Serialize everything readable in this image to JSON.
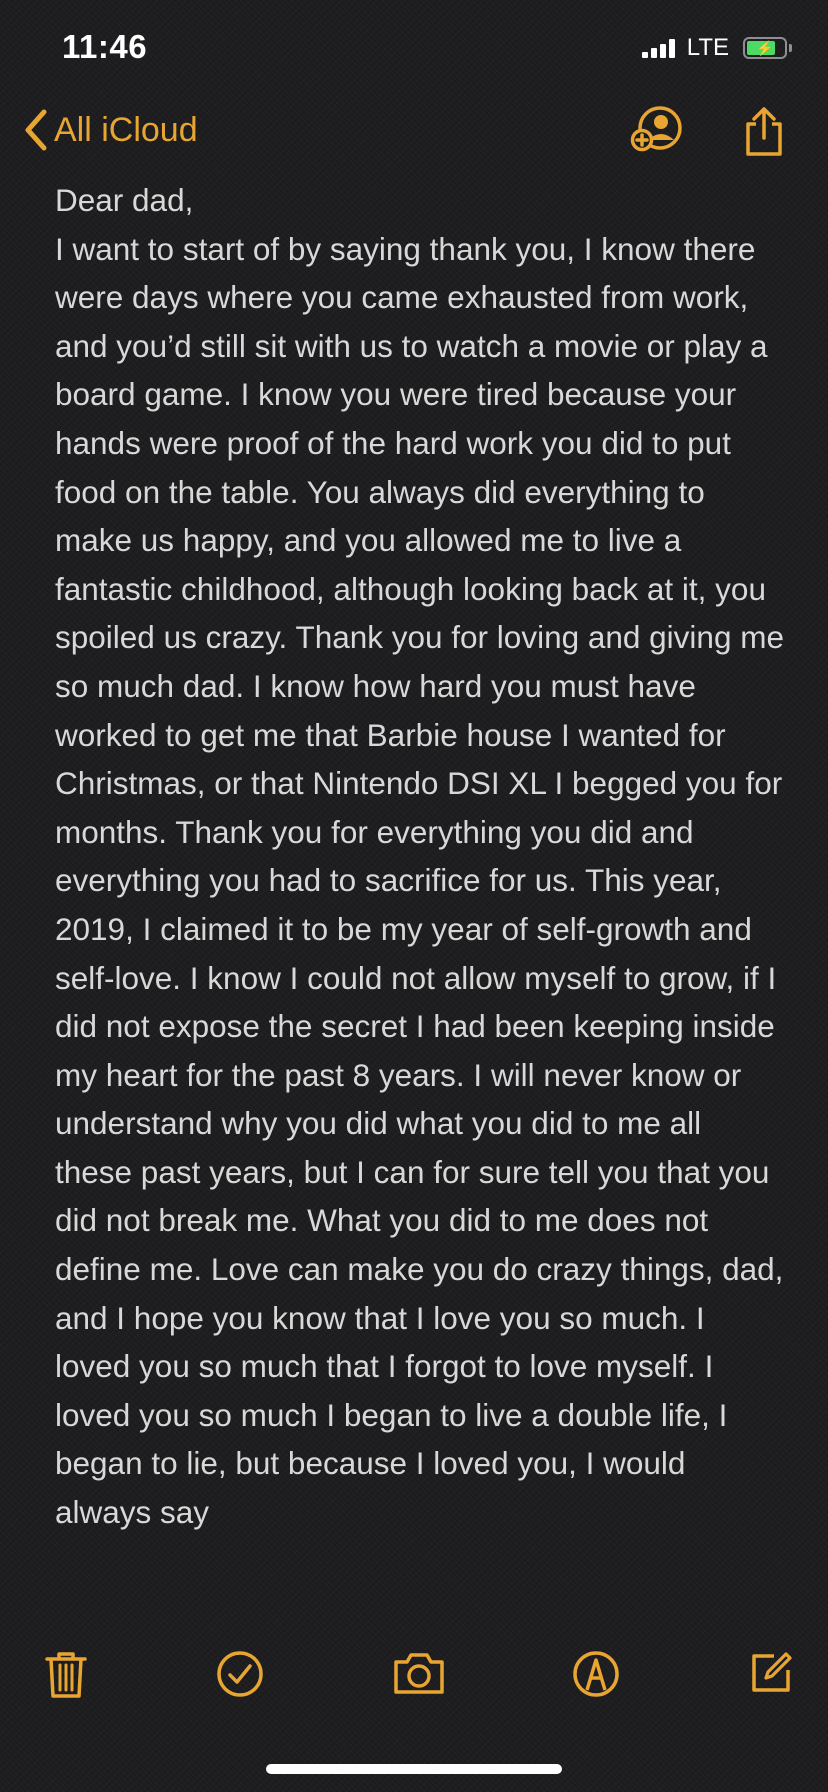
{
  "status_bar": {
    "time": "11:46",
    "network": "LTE",
    "battery_level": 0.7,
    "battery_charging": true,
    "signal_bars": 4
  },
  "nav": {
    "back_label": "All iCloud",
    "accent_color": "#e8a532",
    "icons": [
      "back-chevron-icon",
      "add-person-icon",
      "share-icon"
    ]
  },
  "note": {
    "text": "Dear dad,\nI want to start of by saying thank you, I know there were days where you came exhausted from work, and you’d still sit with us to watch a movie or play a board game. I know you were tired because your hands were proof of the hard work you did to put food on the table. You always did everything to make us happy, and you allowed me to live a fantastic childhood, although looking back at it, you spoiled us crazy. Thank you for loving and giving me so much dad. I know how hard you must have worked to get me that Barbie house I wanted for Christmas, or that Nintendo DSI XL I begged you for months. Thank you for everything you did and everything you had to sacrifice for us. This year, 2019, I claimed it to be my year of self-growth and self-love. I know I could not allow myself to grow, if I did not expose the secret I had been keeping inside my heart for the past 8 years. I will never know or understand why you did what you did to me all these past years, but I can for sure tell you that you did not break me. What you did to me does not define me. Love can make you do crazy things, dad, and I hope you know that I love you so much. I loved you so much that I forgot to love myself. I loved you so much I began to live a double life, I began to lie, but because I loved you, I would always say"
  },
  "toolbar": {
    "icons": [
      "trash-icon",
      "checklist-icon",
      "camera-icon",
      "markup-icon",
      "compose-icon"
    ]
  }
}
